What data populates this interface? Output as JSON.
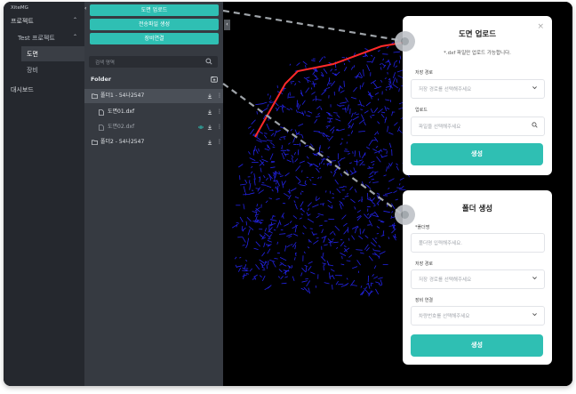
{
  "brand": "XiteMG",
  "nav": {
    "project": "프로젝트",
    "test_project": "Test 프로젝트",
    "drawing": "도면",
    "equipment": "장비",
    "dashboard": "대시보드"
  },
  "panel": {
    "buttons": [
      "도면 업로드",
      "전송파일 생성",
      "장비연결"
    ],
    "search_placeholder": "검색 명역",
    "folder_title": "Folder",
    "tree": [
      {
        "label": "폴더1 - 54나2547",
        "level": 0,
        "icon": "folder-icon"
      },
      {
        "label": "도면01.dxf",
        "level": 1,
        "icon": "file-icon"
      },
      {
        "label": "도면02.dxf",
        "level": 1,
        "icon": "file-icon"
      },
      {
        "label": "폴더2 - 54나2547",
        "level": 0,
        "icon": "folder-icon"
      }
    ]
  },
  "upload_card": {
    "title": "도면 업로드",
    "subtitle": "*.dxf 파일만 업로드 가능합니다.",
    "path_label": "저장 경로",
    "path_placeholder": "저장 경로를 선택해주세요",
    "upload_label": "업로드",
    "file_placeholder": "파일을 선택해주세요",
    "button": "생성"
  },
  "folder_card": {
    "title": "폴더 생성",
    "name_label": "*폴더명",
    "name_placeholder": "폴더명 입력해주세요.",
    "path_label": "저장 경로",
    "path_placeholder": "저장 경로를 선택해주세요",
    "equip_label": "장비 연결",
    "equip_placeholder": "차량번호를 선택해주세요",
    "button": "생성"
  },
  "colors": {
    "accent": "#2fbfb3",
    "nav_bg": "#25282e",
    "panel_bg": "#363a41",
    "drawing_blue": "#2323e8",
    "drawing_red": "#ff2a2a"
  }
}
